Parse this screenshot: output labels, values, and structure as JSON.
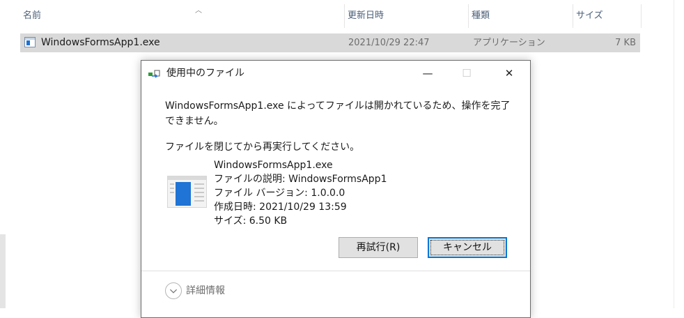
{
  "explorer": {
    "columns": {
      "name": "名前",
      "modified": "更新日時",
      "type": "種類",
      "size": "サイズ"
    },
    "file": {
      "name": "WindowsFormsApp1.exe",
      "modified": "2021/10/29 22:47",
      "type": "アプリケーション",
      "size": "7 KB"
    }
  },
  "dialog": {
    "title": "使用中のファイル",
    "minimize_glyph": "—",
    "maximize_glyph": "☐",
    "close_glyph": "✕",
    "message": "WindowsFormsApp1.exe によってファイルは開かれているため、操作を完了できません。",
    "instruction": "ファイルを閉じてから再実行してください。",
    "file_info": {
      "name": "WindowsFormsApp1.exe",
      "description": "ファイルの説明: WindowsFormsApp1",
      "version": "ファイル バージョン: 1.0.0.0",
      "created": "作成日時: 2021/10/29 13:59",
      "size": "サイズ: 6.50 KB"
    },
    "buttons": {
      "retry": "再試行(R)",
      "cancel": "キャンセル"
    },
    "details_label": "詳細情報"
  },
  "colors": {
    "accent": "#0078d7",
    "selected_row": "#d9d9d9",
    "icon_blue": "#1f74d5"
  }
}
